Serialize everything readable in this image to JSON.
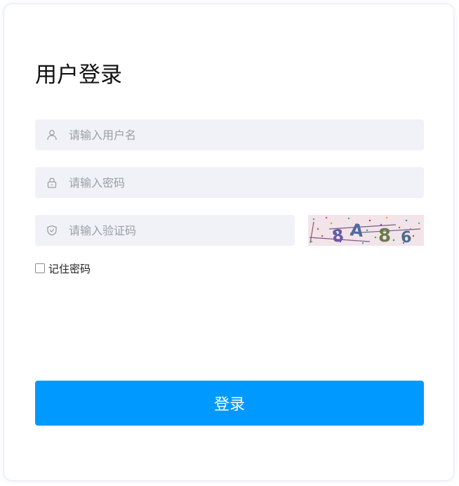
{
  "page_title": "用户登录",
  "username": {
    "placeholder": "请输入用户名",
    "value": "",
    "icon": "user-icon"
  },
  "password": {
    "placeholder": "请输入密码",
    "value": "",
    "icon": "lock-icon"
  },
  "captcha": {
    "placeholder": "请输入验证码",
    "value": "",
    "icon": "shield-icon",
    "image_text": [
      "8",
      "A",
      "8",
      "6"
    ]
  },
  "remember": {
    "label": "记住密码",
    "checked": false
  },
  "login_button": {
    "label": "登录"
  },
  "colors": {
    "primary": "#0099ff",
    "input_bg": "#f0f2f7",
    "captcha_bg": "#f2e4e8"
  }
}
